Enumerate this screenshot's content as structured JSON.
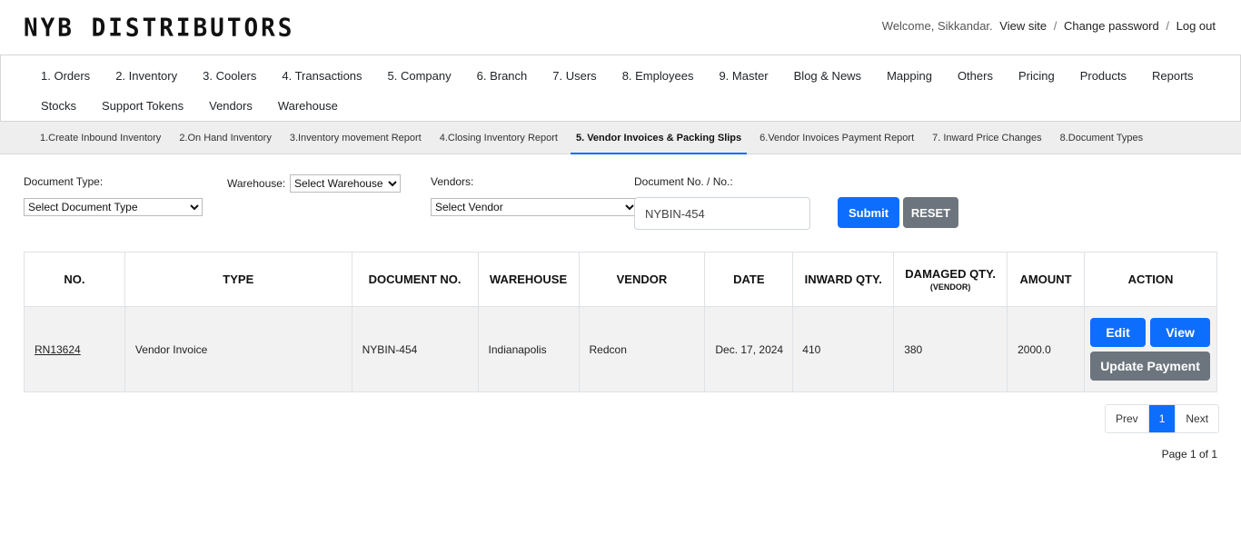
{
  "header": {
    "brand": "NYB DISTRIBUTORS",
    "welcome": "Welcome, Sikkandar.",
    "view_site": "View site",
    "change_password": "Change password",
    "log_out": "Log out",
    "separator": "/"
  },
  "main_nav": {
    "row1": [
      "1. Orders",
      "2. Inventory",
      "3. Coolers",
      "4. Transactions",
      "5. Company",
      "6. Branch",
      "7. Users",
      "8. Employees",
      "9. Master",
      "Blog & News",
      "Mapping",
      "Others",
      "Pricing",
      "Products",
      "Reports"
    ],
    "row2": [
      "Stocks",
      "Support Tokens",
      "Vendors",
      "Warehouse"
    ]
  },
  "sub_nav": {
    "items": [
      "1.Create Inbound Inventory",
      "2.On Hand Inventory",
      "3.Inventory movement Report",
      "4.Closing Inventory Report",
      "5. Vendor Invoices & Packing Slips",
      "6.Vendor Invoices Payment Report",
      "7. Inward Price Changes",
      "8.Document Types"
    ],
    "active_index": 4
  },
  "filters": {
    "document_type_label": "Document Type:",
    "document_type_selected": "Select Document Type",
    "warehouse_label": "Warehouse:",
    "warehouse_selected": "Select Warehouse",
    "vendors_label": "Vendors:",
    "vendor_selected": "Select Vendor",
    "document_no_label": "Document No. / No.:",
    "document_no_value": "NYBIN-454",
    "submit_label": "Submit",
    "reset_label": "RESET"
  },
  "table": {
    "headers": {
      "no": "NO.",
      "type": "TYPE",
      "document_no": "DOCUMENT NO.",
      "warehouse": "WAREHOUSE",
      "vendor": "VENDOR",
      "date": "DATE",
      "inward_qty": "INWARD QTY.",
      "damaged_qty": "DAMAGED QTY.",
      "damaged_qty_sub": "(VENDOR)",
      "amount": "AMOUNT",
      "action": "ACTION"
    },
    "rows": [
      {
        "no": "RN13624",
        "type": "Vendor Invoice",
        "document_no": "NYBIN-454",
        "warehouse": "Indianapolis",
        "vendor": "Redcon",
        "date": "Dec. 17, 2024",
        "inward_qty": "410",
        "damaged_qty": "380",
        "amount": "2000.0",
        "edit_label": "Edit",
        "view_label": "View",
        "update_payment_label": "Update Payment"
      }
    ]
  },
  "pagination": {
    "prev": "Prev",
    "current": "1",
    "next": "Next",
    "page_info": "Page 1 of 1"
  },
  "colors": {
    "primary": "#0d6efd",
    "secondary": "#6c757d",
    "row_bg": "#f2f2f2",
    "subnav_bg": "#eeeeee"
  }
}
